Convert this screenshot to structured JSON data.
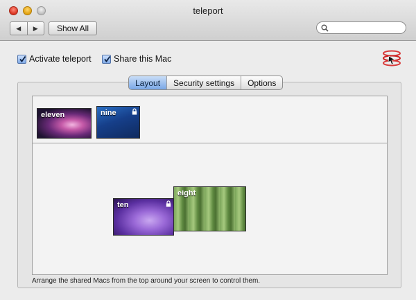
{
  "window": {
    "title": "teleport"
  },
  "toolbar": {
    "back_glyph": "◀",
    "forward_glyph": "▶",
    "show_all_label": "Show All",
    "search_placeholder": ""
  },
  "options": {
    "activate": {
      "label": "Activate teleport",
      "checked": true
    },
    "share": {
      "label": "Share this Mac",
      "checked": true
    }
  },
  "tabs": [
    {
      "label": "Layout",
      "active": true
    },
    {
      "label": "Security settings",
      "active": false
    },
    {
      "label": "Options",
      "active": false
    }
  ],
  "shared_macs": [
    {
      "name": "eleven",
      "locked": false
    },
    {
      "name": "nine",
      "locked": true
    }
  ],
  "arranged_macs": [
    {
      "name": "ten",
      "locked": true
    },
    {
      "name": "eight",
      "locked": false
    }
  ],
  "hint": "Arrange the shared Macs from the top around your screen to control them.",
  "colors": {
    "tab_active": "#79a7e6",
    "checkbox": "#7fa9e6",
    "icon_accent": "#d83a3a"
  },
  "icons": {
    "app": "teleport-icon",
    "search": "search-icon",
    "lock": "lock-icon"
  }
}
